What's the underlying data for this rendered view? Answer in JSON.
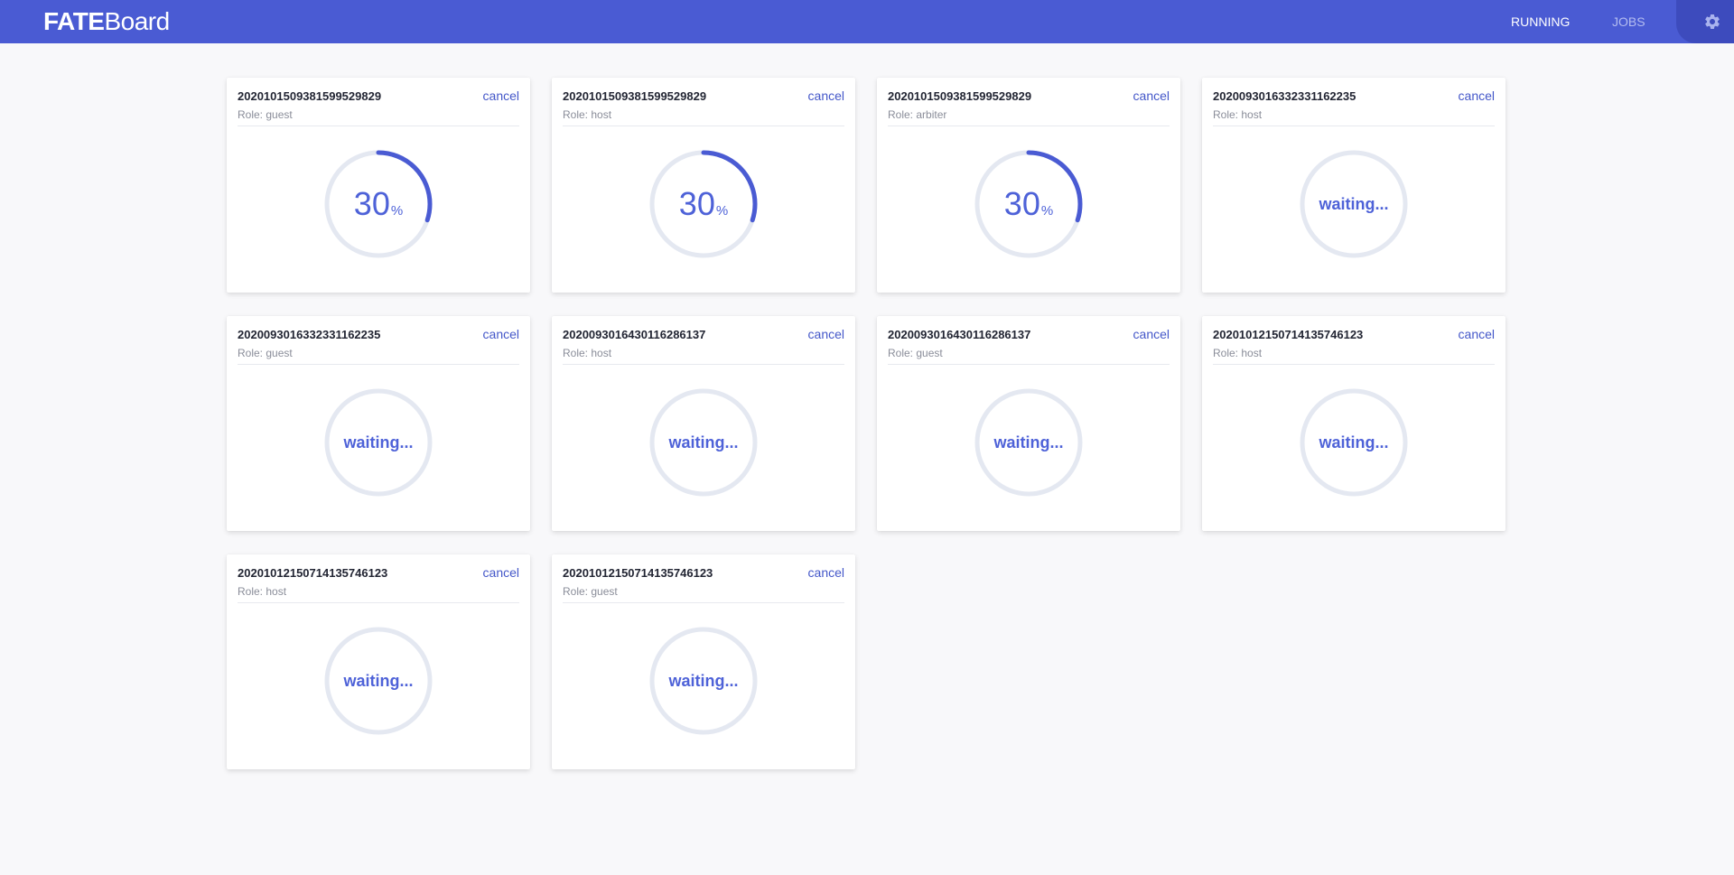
{
  "header": {
    "logo_bold": "FATE",
    "logo_rest": "Board",
    "nav": {
      "running": "RUNNING",
      "jobs": "JOBS"
    },
    "settings_icon": "gear-icon"
  },
  "colors": {
    "header": "#4a5bd3",
    "accent": "#4457c9",
    "progress": "#4a5bd3",
    "track": "#e4e8f1"
  },
  "jobs": [
    {
      "id": "2020101509381599529829",
      "role": "Role: guest",
      "cancel": "cancel",
      "status": "running",
      "progress": 30,
      "percent_symbol": "%"
    },
    {
      "id": "20201015093815995298 29",
      "role": "Role: host",
      "cancel": "cancel",
      "status": "running",
      "progress": 30,
      "percent_symbol": "%"
    },
    {
      "id": "2020101509381599529829",
      "role": "Role: arbiter",
      "cancel": "cancel",
      "status": "running",
      "progress": 30,
      "percent_symbol": "%"
    },
    {
      "id": "2020093016332331162235",
      "role": "Role: host",
      "cancel": "cancel",
      "status": "waiting",
      "waiting_text": "waiting..."
    },
    {
      "id": "2020093016332331162235",
      "role": "Role: guest",
      "cancel": "cancel",
      "status": "waiting",
      "waiting_text": "waiting..."
    },
    {
      "id": "2020093016430116286137",
      "role": "Role: host",
      "cancel": "cancel",
      "status": "waiting",
      "waiting_text": "waiting..."
    },
    {
      "id": "2020093016430116286137",
      "role": "Role: guest",
      "cancel": "cancel",
      "status": "waiting",
      "waiting_text": "waiting..."
    },
    {
      "id": "2020101215071413574 6123",
      "role": "Role: host",
      "cancel": "cancel",
      "status": "waiting",
      "waiting_text": "waiting..."
    },
    {
      "id": "2020101215071413574612 3",
      "role": "Role: host",
      "cancel": "cancel",
      "status": "waiting",
      "waiting_text": "waiting..."
    },
    {
      "id": "2020101215071413574612 3",
      "role": "Role: guest",
      "cancel": "cancel",
      "status": "waiting",
      "waiting_text": "waiting..."
    }
  ]
}
